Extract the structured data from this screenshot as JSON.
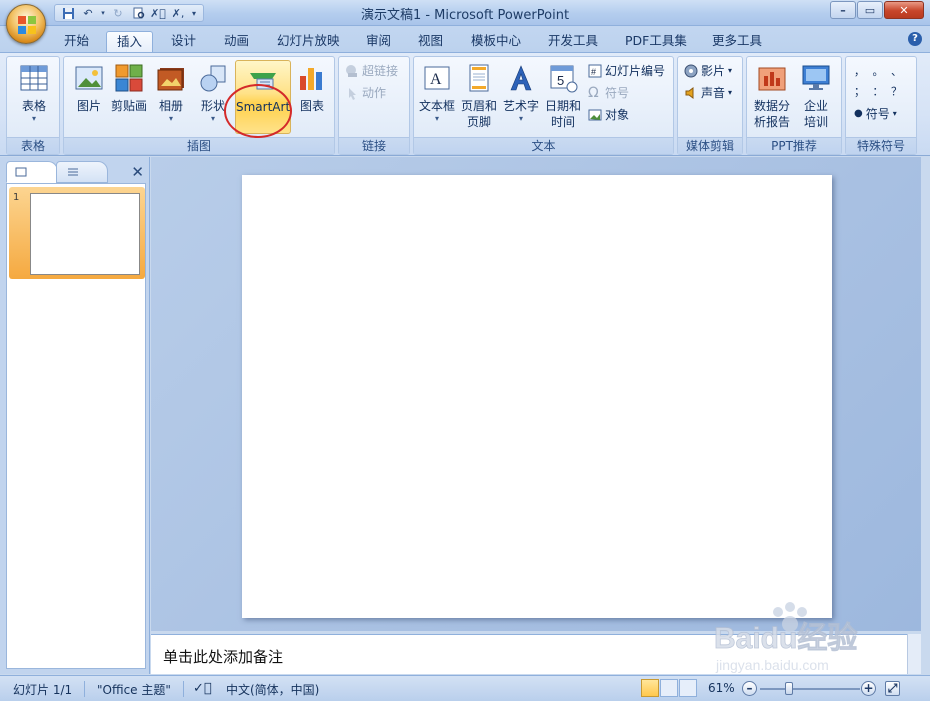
{
  "window": {
    "title": "演示文稿1 - Microsoft PowerPoint",
    "controls": [
      "minimize-icon",
      "maximize-icon",
      "close-icon"
    ]
  },
  "quick_access": [
    "save-icon",
    "undo-icon",
    "redo-icon",
    "print-preview-icon",
    "spell-icon",
    "customize-icon"
  ],
  "tabs": [
    {
      "label": "开始",
      "active": false
    },
    {
      "label": "插入",
      "active": true
    },
    {
      "label": "设计",
      "active": false
    },
    {
      "label": "动画",
      "active": false
    },
    {
      "label": "幻灯片放映",
      "active": false
    },
    {
      "label": "审阅",
      "active": false
    },
    {
      "label": "视图",
      "active": false
    },
    {
      "label": "模板中心",
      "active": false
    },
    {
      "label": "开发工具",
      "active": false
    },
    {
      "label": "PDF工具集",
      "active": false
    },
    {
      "label": "更多工具",
      "active": false
    }
  ],
  "ribbon": {
    "groups": {
      "table": {
        "label": "表格",
        "buttons": {
          "table": "表格"
        }
      },
      "illustrations": {
        "label": "插图",
        "buttons": {
          "picture": "图片",
          "clipart": "剪贴画",
          "album": "相册",
          "shapes": "形状",
          "smartart": "SmartArt",
          "chart": "图表"
        }
      },
      "links": {
        "label": "链接",
        "buttons": {
          "hyperlink": "超链接",
          "action": "动作"
        }
      },
      "text": {
        "label": "文本",
        "buttons": {
          "textbox": "文本框",
          "header1": "页眉和",
          "header2": "页脚",
          "wordart": "艺术字",
          "date1": "日期和",
          "date2": "时间",
          "slide_number": "幻灯片编号",
          "symbol": "符号",
          "object": "对象"
        }
      },
      "media": {
        "label": "媒体剪辑",
        "buttons": {
          "movie": "影片",
          "sound": "声音"
        }
      },
      "ppt": {
        "label": "PPT推荐",
        "buttons": {
          "report1": "数据分",
          "report2": "析报告",
          "training1": "企业",
          "training2": "培训"
        }
      },
      "special": {
        "label": "特殊符号",
        "buttons": {
          "symbol": "符号"
        },
        "marks_row1": "，  。  、",
        "marks_row2": "；  ：  ？"
      }
    }
  },
  "slides_panel": {
    "slide_number": "1"
  },
  "notes": {
    "placeholder": "单击此处添加备注"
  },
  "status": {
    "slide": "幻灯片 1/1",
    "theme": "\"Office 主题\"",
    "language": "中文(简体，中国)",
    "zoom": "61%"
  },
  "watermark": {
    "text": "Baidu经验",
    "sub": "jingyan.baidu.com"
  },
  "colors": {
    "ribbon": "#dce7f7",
    "highlight": "#ffd14c",
    "circle": "#d42a2a",
    "thumb_select": "#f5a940"
  }
}
